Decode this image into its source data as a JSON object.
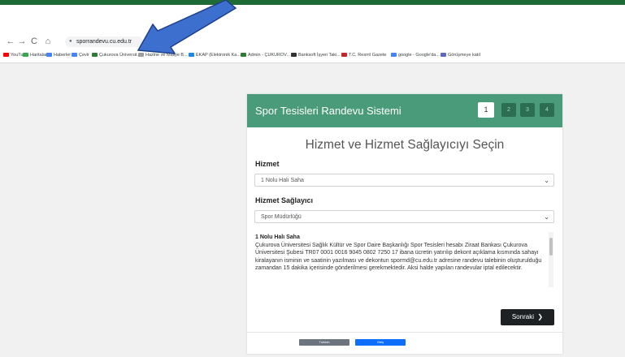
{
  "browser": {
    "url": "sporrandevu.cu.edu.tr",
    "bookmarks": [
      {
        "label": "YouTube",
        "color": "#ff0000"
      },
      {
        "label": "Haritalar",
        "color": "#34a853"
      },
      {
        "label": "Haberler",
        "color": "#4285f4"
      },
      {
        "label": "Çevir",
        "color": "#4285f4"
      },
      {
        "label": "Çukurova Üniversit...",
        "color": "#2e7d32"
      },
      {
        "label": "Hazine ve Maliye B...",
        "color": "#9e9e9e"
      },
      {
        "label": "EKAP (Elektronik Ka...",
        "color": "#1e88e5"
      },
      {
        "label": "Admin - ÇUKUROV...",
        "color": "#2e7d32"
      },
      {
        "label": "Banksoft İşyeri Taki...",
        "color": "#333333"
      },
      {
        "label": "T.C. Resmî Gazete",
        "color": "#c62828"
      },
      {
        "label": "google - Google'da...",
        "color": "#4285f4"
      },
      {
        "label": "Görüşmeye katıl",
        "color": "#5c6bc0"
      }
    ]
  },
  "card": {
    "title": "Spor Tesisleri Randevu Sistemi",
    "steps": [
      "1",
      "2",
      "3",
      "4"
    ],
    "subtitle": "Hizmet ve Hizmet Sağlayıcıyı Seçin",
    "service_label": "Hizmet",
    "service_value": "1 Nolu Halı Saha",
    "provider_label": "Hizmet Sağlayıcı",
    "provider_value": "Spor Müdürlüğü",
    "info_title": "1 Nolu Halı Saha",
    "info_text": "Çukurova Üniversitesi Sağlık Kültür ve Spor Daire Başkanlığı Spor Tesisleri hesabı Ziraat Bankası Çukurova Üniversitesi Şubesi TR07 0001 0016 9045 0802 7250 17 ibana ücretin yatırılıp dekont açıklama kısmında sahayı kiralayanın isminin ve saatinin yazılması ve dekontun spormd@cu.edu.tr adresine randevu talebinin oluşturulduğu zamandan 15 dakika içerisinde gönderilmesi gerekmektedir. Aksi halde yapılan randevular iptal edilecektir.",
    "next_label": "Sonraki",
    "lang_tr": "Turkish",
    "lang_en": "Giriş"
  },
  "colors": {
    "header_green": "#4a9b7a",
    "step_dark": "#2c6e52",
    "arrow_blue": "#3d6fcf"
  }
}
